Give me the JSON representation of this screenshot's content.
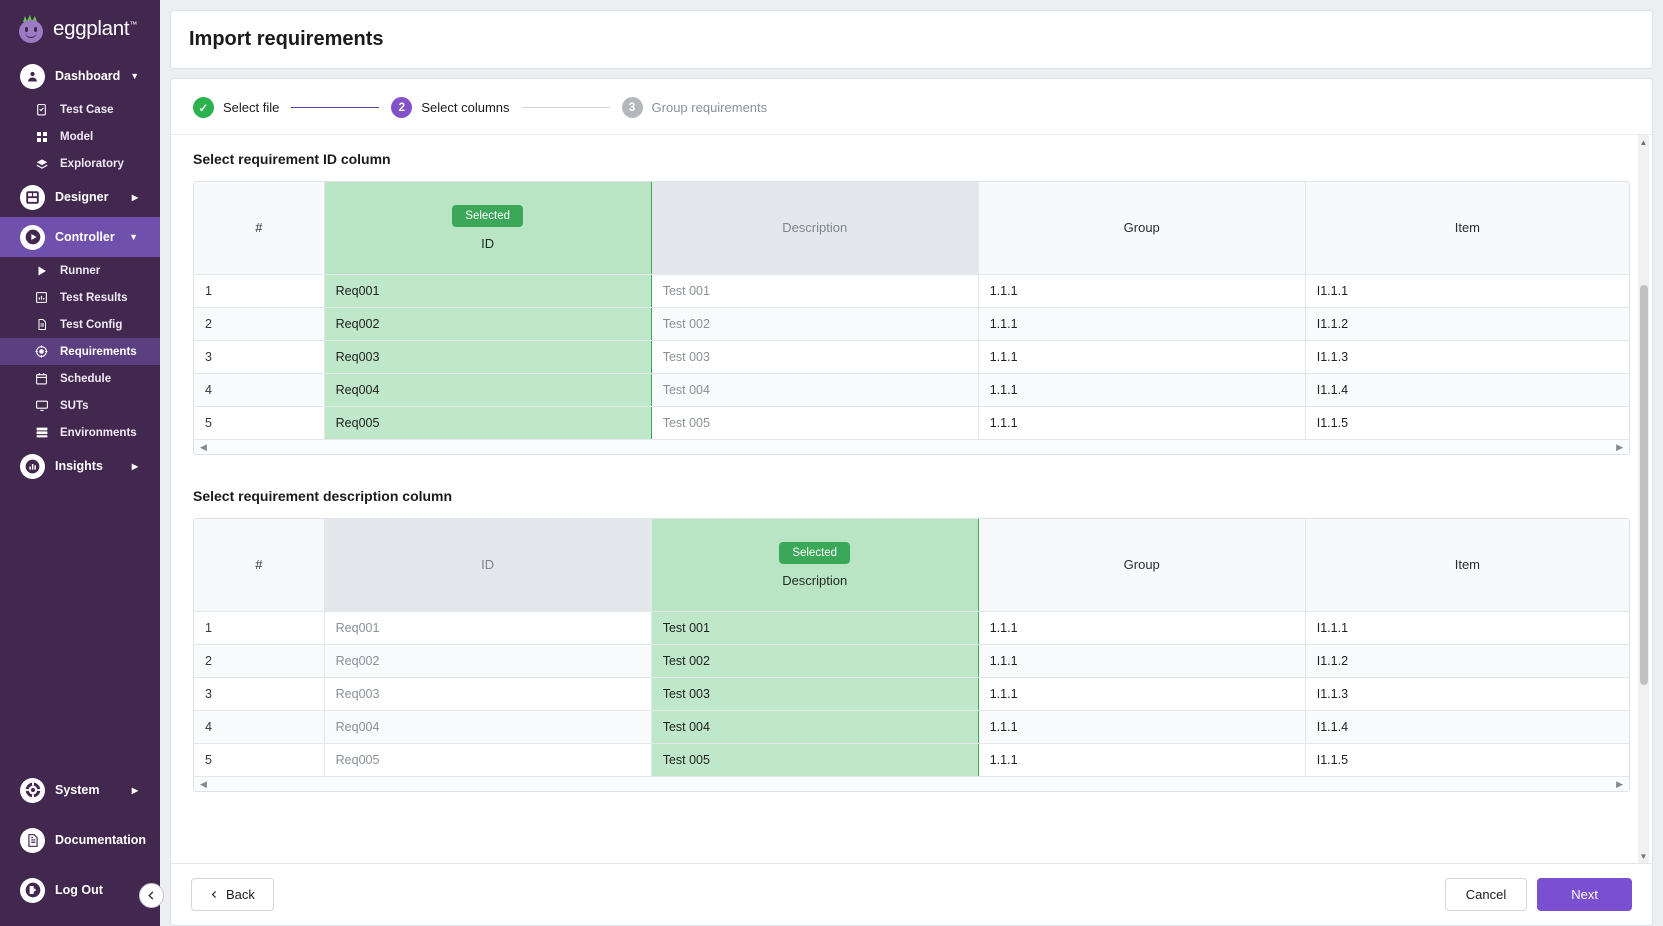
{
  "brand": {
    "name": "eggplant",
    "tm": "™",
    "logo_icon": "eggplant-logo"
  },
  "sidebar": {
    "groups": [
      {
        "label": "Dashboard",
        "icon": "dashboard-icon",
        "caret": "▼",
        "active": false,
        "items": [
          {
            "label": "Test Case",
            "icon": "test-case-icon"
          },
          {
            "label": "Model",
            "icon": "model-grid-icon"
          },
          {
            "label": "Exploratory",
            "icon": "exploratory-icon"
          }
        ]
      },
      {
        "label": "Designer",
        "icon": "designer-icon",
        "caret": "▶",
        "active": false,
        "items": []
      },
      {
        "label": "Controller",
        "icon": "controller-play-icon",
        "caret": "▼",
        "active": true,
        "items": [
          {
            "label": "Runner",
            "icon": "runner-play-icon"
          },
          {
            "label": "Test Results",
            "icon": "test-results-chart-icon"
          },
          {
            "label": "Test Config",
            "icon": "test-config-doc-icon"
          },
          {
            "label": "Requirements",
            "icon": "requirements-target-icon",
            "active": true
          },
          {
            "label": "Schedule",
            "icon": "schedule-calendar-icon"
          },
          {
            "label": "SUTs",
            "icon": "suts-monitor-icon"
          },
          {
            "label": "Environments",
            "icon": "environments-stack-icon"
          }
        ]
      },
      {
        "label": "Insights",
        "icon": "insights-chart-icon",
        "caret": "▶",
        "active": false,
        "items": []
      }
    ],
    "bottom": [
      {
        "label": "System",
        "icon": "system-gear-icon",
        "caret": "▶"
      },
      {
        "label": "Documentation",
        "icon": "documentation-icon",
        "caret": ""
      },
      {
        "label": "Log Out",
        "icon": "logout-icon",
        "caret": ""
      }
    ],
    "collapse_icon": "chevron-left-icon"
  },
  "header": {
    "title": "Import requirements"
  },
  "stepper": {
    "steps": [
      {
        "num": "✓",
        "label": "Select file",
        "state": "done"
      },
      {
        "num": "2",
        "label": "Select columns",
        "state": "current"
      },
      {
        "num": "3",
        "label": "Group requirements",
        "state": "todo"
      }
    ]
  },
  "sections": [
    {
      "title": "Select requirement ID column",
      "selected_column": "ID",
      "selected_badge": "Selected",
      "columns": [
        {
          "key": "hash",
          "label": "#",
          "style": "plain"
        },
        {
          "key": "id",
          "label": "ID",
          "style": "selected"
        },
        {
          "key": "desc",
          "label": "Description",
          "style": "dim"
        },
        {
          "key": "group",
          "label": "Group",
          "style": "plain"
        },
        {
          "key": "item",
          "label": "Item",
          "style": "plain"
        }
      ],
      "rows": [
        {
          "hash": "1",
          "id": "Req001",
          "desc": "Test 001",
          "group": "1.1.1",
          "item": "I1.1.1"
        },
        {
          "hash": "2",
          "id": "Req002",
          "desc": "Test 002",
          "group": "1.1.1",
          "item": "I1.1.2"
        },
        {
          "hash": "3",
          "id": "Req003",
          "desc": "Test 003",
          "group": "1.1.1",
          "item": "I1.1.3"
        },
        {
          "hash": "4",
          "id": "Req004",
          "desc": "Test 004",
          "group": "1.1.1",
          "item": "I1.1.4"
        },
        {
          "hash": "5",
          "id": "Req005",
          "desc": "Test 005",
          "group": "1.1.1",
          "item": "I1.1.5"
        }
      ]
    },
    {
      "title": "Select requirement description column",
      "selected_column": "Description",
      "selected_badge": "Selected",
      "columns": [
        {
          "key": "hash",
          "label": "#",
          "style": "plain"
        },
        {
          "key": "id",
          "label": "ID",
          "style": "dim"
        },
        {
          "key": "desc",
          "label": "Description",
          "style": "selected"
        },
        {
          "key": "group",
          "label": "Group",
          "style": "plain"
        },
        {
          "key": "item",
          "label": "Item",
          "style": "plain"
        }
      ],
      "rows": [
        {
          "hash": "1",
          "id": "Req001",
          "desc": "Test 001",
          "group": "1.1.1",
          "item": "I1.1.1"
        },
        {
          "hash": "2",
          "id": "Req002",
          "desc": "Test 002",
          "group": "1.1.1",
          "item": "I1.1.2"
        },
        {
          "hash": "3",
          "id": "Req003",
          "desc": "Test 003",
          "group": "1.1.1",
          "item": "I1.1.3"
        },
        {
          "hash": "4",
          "id": "Req004",
          "desc": "Test 004",
          "group": "1.1.1",
          "item": "I1.1.4"
        },
        {
          "hash": "5",
          "id": "Req005",
          "desc": "Test 005",
          "group": "1.1.1",
          "item": "I1.1.5"
        }
      ]
    }
  ],
  "footer": {
    "back_label": "Back",
    "back_icon": "chevron-left-icon",
    "cancel_label": "Cancel",
    "next_label": "Next"
  },
  "colors": {
    "sidebar_bg": "#42284f",
    "sidebar_active": "#6f50ad",
    "sidebar_subactive": "#5b3f80",
    "accent_purple": "#7a4fd0",
    "step_done_green": "#2bb14e",
    "selected_green_bg": "#bfe7c9",
    "selected_badge_green": "#3ba758",
    "page_bg": "#eceef1"
  }
}
